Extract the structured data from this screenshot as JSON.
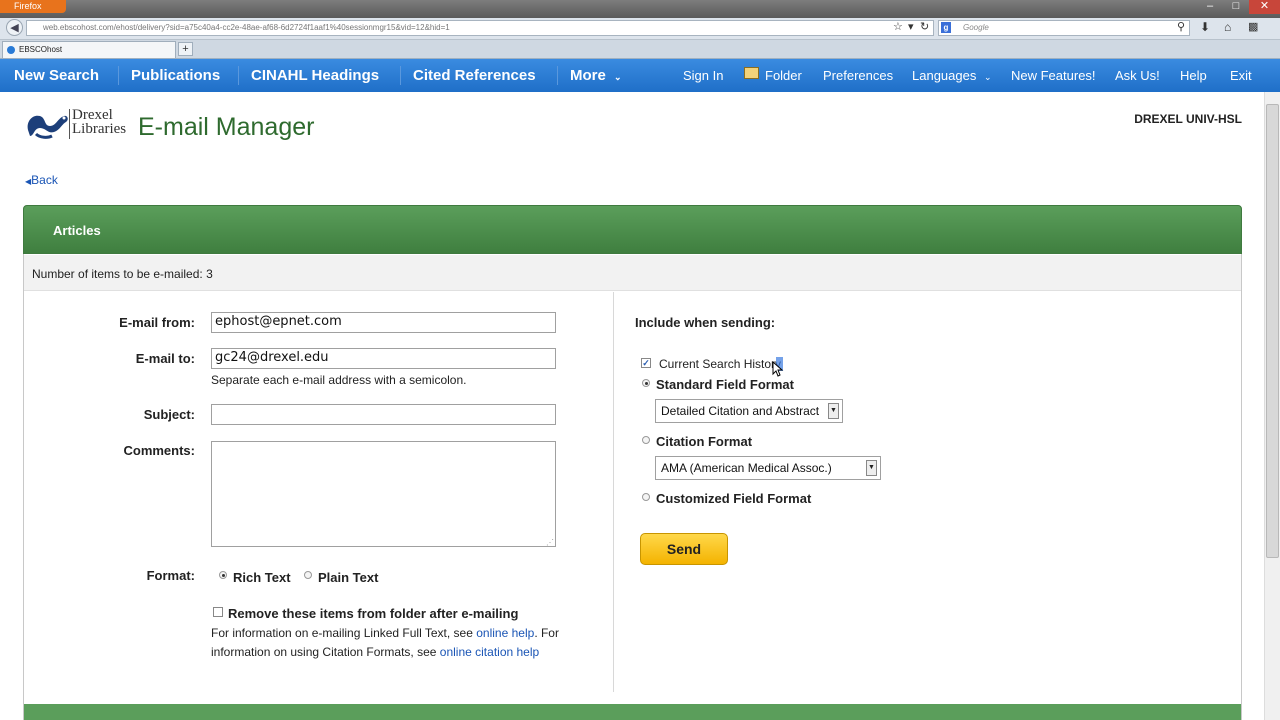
{
  "browser": {
    "app_button": "Firefox",
    "url": "web.ebscohost.com/ehost/delivery?sid=a75c40a4-cc2e-48ae-af68-6d2724f1aaf1%40sessionmgr15&vid=12&hid=1",
    "search_placeholder": "Google",
    "tab_title": "EBSCOhost"
  },
  "topnav": {
    "new_search": "New Search",
    "publications": "Publications",
    "cinahl": "CINAHL Headings",
    "cited": "Cited References",
    "more": "More",
    "sign_in": "Sign In",
    "folder": "Folder",
    "preferences": "Preferences",
    "languages": "Languages",
    "new_features": "New Features!",
    "ask_us": "Ask Us!",
    "help": "Help",
    "exit": "Exit"
  },
  "header": {
    "logo_line1": "Drexel",
    "logo_line2": "Libraries",
    "title": "E-mail Manager",
    "institution": "DREXEL UNIV-HSL"
  },
  "back_label": "Back",
  "panel": {
    "title": "Articles",
    "count_label": "Number of items to be e-mailed: 3"
  },
  "form": {
    "from_label": "E-mail from:",
    "from_value": "ephost@epnet.com",
    "to_label": "E-mail to:",
    "to_value": "gc24@drexel.edu",
    "to_hint": "Separate each e-mail address with a semicolon.",
    "subject_label": "Subject:",
    "subject_value": "",
    "comments_label": "Comments:",
    "comments_value": "",
    "format_label": "Format:",
    "format_rich": "Rich Text",
    "format_plain": "Plain Text",
    "remove_label": "Remove these items from folder after e-mailing",
    "info_1": "For information on e-mailing Linked Full Text, see ",
    "info_link1": "online help",
    "info_2": ".  For",
    "info_3": "information on using Citation Formats, see ",
    "info_link2": "online citation help"
  },
  "include": {
    "heading": "Include when sending:",
    "search_history": "Current Search History",
    "standard": "Standard Field Format",
    "standard_select": "Detailed Citation and Abstract",
    "citation": "Citation Format",
    "citation_select": "AMA (American Medical Assoc.)",
    "customized": "Customized Field Format",
    "send": "Send"
  },
  "colors": {
    "nav_blue": "#2a7bd6",
    "header_green": "#4a8c4a",
    "title_green": "#2e6a2e",
    "send_yellow": "#f7c31c",
    "link_blue": "#1a55b5"
  }
}
